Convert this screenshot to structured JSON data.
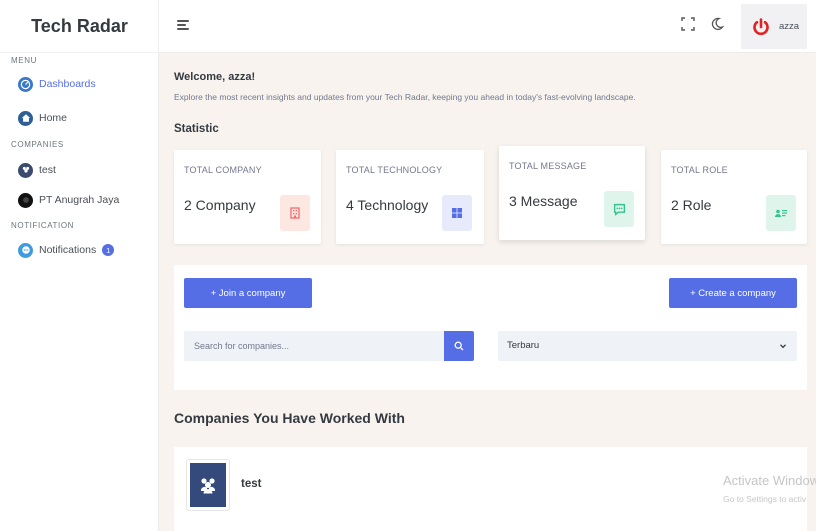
{
  "app": {
    "brand": "Tech Radar"
  },
  "sidebar": {
    "sections": {
      "menu": "MENU",
      "companies": "COMPANIES",
      "notification": "NOTIFICATION"
    },
    "items": {
      "dashboards": "Dashboards",
      "home": "Home",
      "test": "test",
      "pt": "PT Anugrah Jaya",
      "notifications": "Notifications",
      "notifications_count": "1"
    },
    "active_item": "Dashboards"
  },
  "header": {
    "username": "azza",
    "icons": [
      "menu-icon",
      "fullscreen-icon",
      "moon-icon",
      "power-icon"
    ]
  },
  "welcome": {
    "title": "Welcome, azza!",
    "subtitle": "Explore the most recent insights and updates from your Tech Radar, keeping you ahead in today's fast-evolving landscape."
  },
  "statistic": {
    "title": "Statistic",
    "cards": [
      {
        "label": "TOTAL COMPANY",
        "value": "2 Company",
        "icon": "building-icon",
        "color": "#f46a6a"
      },
      {
        "label": "TOTAL TECHNOLOGY",
        "value": "4 Technology",
        "icon": "windows-icon",
        "color": "#556ee6"
      },
      {
        "label": "TOTAL MESSAGE",
        "value": "3 Message",
        "icon": "message-icon",
        "color": "#34c38f"
      },
      {
        "label": "TOTAL ROLE",
        "value": "2 Role",
        "icon": "id-card-icon",
        "color": "#34c38f"
      }
    ]
  },
  "actions": {
    "join": "+ Join a company",
    "create": "+ Create a company",
    "search_placeholder": "Search for companies...",
    "sort_selected": "Terbaru"
  },
  "companies": {
    "title": "Companies You Have Worked With",
    "items": [
      {
        "name": "test"
      }
    ]
  },
  "watermark": {
    "title": "Activate Window",
    "sub": "Go to Settings to activ"
  },
  "colors": {
    "primary": "#556ee6",
    "background": "#f8f3ef",
    "danger": "#f46a6a",
    "success": "#34c38f"
  }
}
